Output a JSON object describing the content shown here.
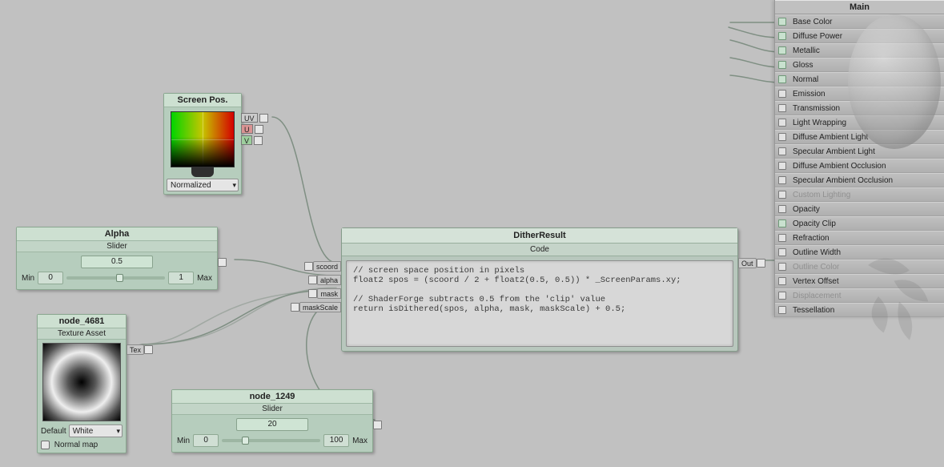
{
  "main": {
    "title": "Main",
    "rows": [
      {
        "label": "Base Color",
        "connected": true
      },
      {
        "label": "Diffuse Power",
        "connected": true
      },
      {
        "label": "Metallic",
        "connected": true
      },
      {
        "label": "Gloss",
        "connected": true
      },
      {
        "label": "Normal",
        "connected": true
      },
      {
        "label": "Emission",
        "connected": false
      },
      {
        "label": "Transmission",
        "connected": false
      },
      {
        "label": "Light Wrapping",
        "connected": false
      },
      {
        "label": "Diffuse Ambient Light",
        "connected": false
      },
      {
        "label": "Specular Ambient Light",
        "connected": false
      },
      {
        "label": "Diffuse Ambient Occlusion",
        "connected": false
      },
      {
        "label": "Specular Ambient Occlusion",
        "connected": false
      },
      {
        "label": "Custom Lighting",
        "disabled": true
      },
      {
        "label": "Opacity",
        "connected": false
      },
      {
        "label": "Opacity Clip",
        "connected": true
      },
      {
        "label": "Refraction",
        "connected": false
      },
      {
        "label": "Outline Width",
        "connected": false
      },
      {
        "label": "Outline Color",
        "disabled": true
      },
      {
        "label": "Vertex Offset",
        "connected": false
      },
      {
        "label": "Displacement",
        "disabled": true
      },
      {
        "label": "Tessellation",
        "connected": false
      }
    ]
  },
  "screenpos": {
    "title": "Screen Pos.",
    "mode": "Normalized",
    "ports": {
      "uv": "UV",
      "u": "U",
      "v": "V"
    }
  },
  "alpha": {
    "title": "Alpha",
    "subtitle": "Slider",
    "value": "0.5",
    "min": "0",
    "max": "1",
    "minlabel": "Min",
    "maxlabel": "Max"
  },
  "node1249": {
    "title": "node_1249",
    "subtitle": "Slider",
    "value": "20",
    "min": "0",
    "max": "100",
    "minlabel": "Min",
    "maxlabel": "Max"
  },
  "tex": {
    "title": "node_4681",
    "subtitle": "Texture Asset",
    "default_select": "White",
    "default_label": "Default",
    "normal_label": "Normal map",
    "out": "Tex"
  },
  "dither": {
    "title": "DitherResult",
    "subtitle": "Code",
    "out": "Out",
    "ins": [
      "scoord",
      "alpha",
      "mask",
      "maskScale"
    ],
    "code": "// screen space position in pixels\nfloat2 spos = (scoord / 2 + float2(0.5, 0.5)) * _ScreenParams.xy;\n\n// ShaderForge subtracts 0.5 from the 'clip' value\nreturn isDithered(spos, alpha, mask, maskScale) + 0.5;"
  }
}
